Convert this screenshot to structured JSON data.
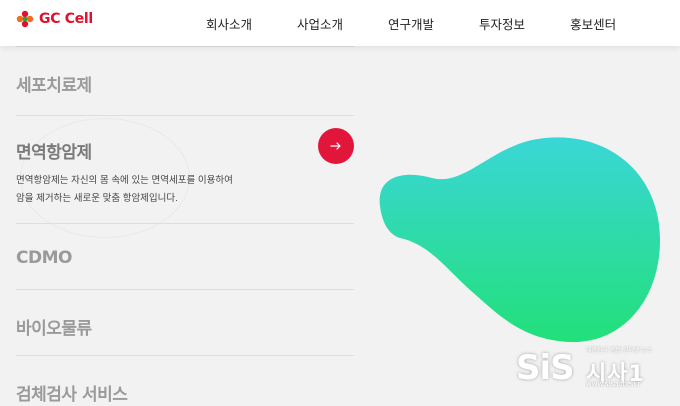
{
  "brand": {
    "logo_text_gc": "GC",
    "logo_text_cell": "Cell",
    "accent": "#e2163a"
  },
  "nav": {
    "items": [
      "회사소개",
      "사업소개",
      "연구개발",
      "투자정보",
      "홍보센터"
    ]
  },
  "business": {
    "items": [
      {
        "label": "세포치료제"
      },
      {
        "label": "면역항암제",
        "desc_line1": "면역항암제는 자신의 몸 속에 있는 면역세포를 이용하여",
        "desc_line2": "암을 제거하는 새로운 맞춤 항암제입니다."
      },
      {
        "label": "CDMO"
      },
      {
        "label": "바이오물류"
      },
      {
        "label": "검체검사 서비스"
      }
    ],
    "active_index": 1
  },
  "blob": {
    "gradient_top": "#3ad6d6",
    "gradient_bottom": "#22e07a"
  },
  "watermark": {
    "main": "SiS",
    "kr": "시사1",
    "tag": "대한민국 종합 인터넷 뉴스",
    "site": "www.sisaone.kr"
  }
}
